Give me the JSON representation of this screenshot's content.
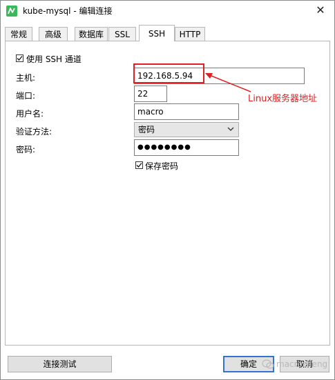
{
  "window": {
    "title": "kube-mysql - 编辑连接",
    "close_glyph": "✕"
  },
  "tabs": [
    {
      "label": "常规"
    },
    {
      "label": "高级"
    },
    {
      "label": "数据库"
    },
    {
      "label": "SSL"
    },
    {
      "label": "SSH",
      "active": true
    },
    {
      "label": "HTTP"
    }
  ],
  "ssh": {
    "use_tunnel_label": "使用 SSH 通道",
    "use_tunnel_checked": true,
    "host_label": "主机:",
    "host_value": "192.168.5.94",
    "port_label": "端口:",
    "port_value": "22",
    "username_label": "用户名:",
    "username_value": "macro",
    "auth_label": "验证方法:",
    "auth_value": "密码",
    "password_label": "密码:",
    "password_value": "●●●●●●●●",
    "save_password_label": "保存密码",
    "save_password_checked": true
  },
  "annotation": {
    "text": "Linux服务器地址",
    "color": "#e02020"
  },
  "buttons": {
    "test": "连接测试",
    "ok": "确定",
    "cancel": "取消"
  },
  "watermark": {
    "text": "macrozheng"
  },
  "colors": {
    "accent": "#3373d6",
    "annotation": "#e02020",
    "icon": "#3bb85a"
  }
}
